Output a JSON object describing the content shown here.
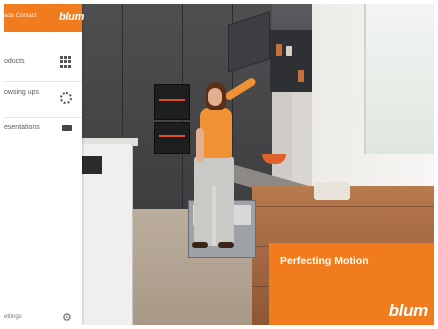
{
  "sidebar": {
    "contact_label": "ada Contact",
    "brand": "blum",
    "items": [
      {
        "label": "oducts",
        "icon": "grid-icon"
      },
      {
        "label": "owsing ups",
        "icon": "ring-icon"
      },
      {
        "label": "esentations",
        "icon": "screen-icon"
      }
    ],
    "footer_label": "ettings",
    "footer_icon": "gear-icon"
  },
  "banner": {
    "tagline": "Perfecting Motion",
    "brand": "blum"
  },
  "colors": {
    "brand_orange": "#f07c1d",
    "sidebar_bg": "#ffffff"
  }
}
